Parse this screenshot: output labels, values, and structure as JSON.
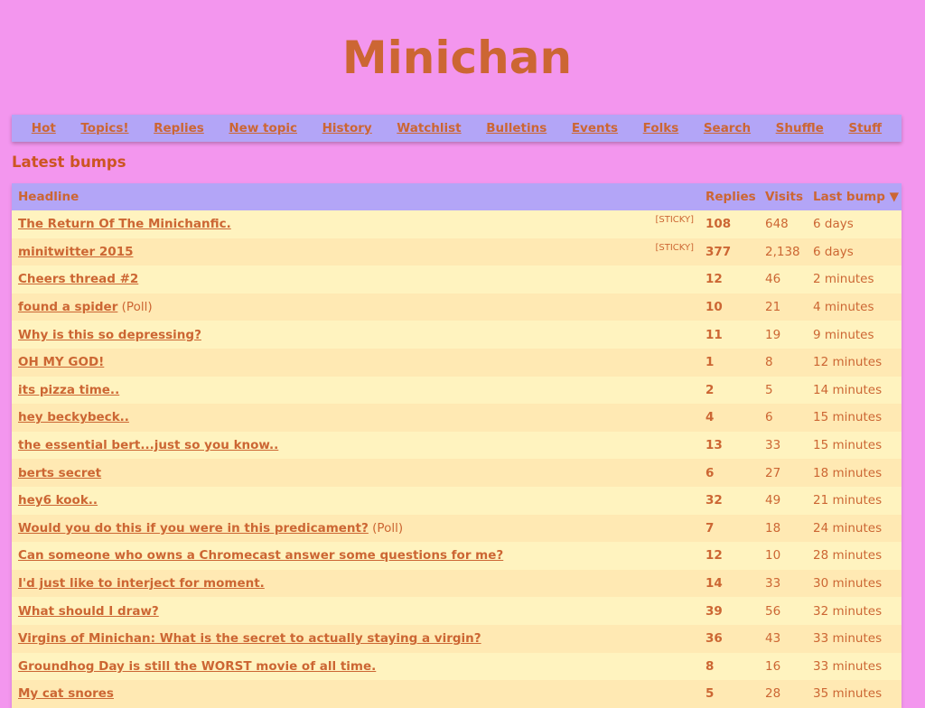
{
  "site": {
    "title": "Minichan"
  },
  "nav": {
    "items": [
      {
        "label": "Hot",
        "name": "nav-hot"
      },
      {
        "label": "Topics!",
        "name": "nav-topics"
      },
      {
        "label": "Replies",
        "name": "nav-replies"
      },
      {
        "label": "New topic",
        "name": "nav-new-topic"
      },
      {
        "label": "History",
        "name": "nav-history"
      },
      {
        "label": "Watchlist",
        "name": "nav-watchlist"
      },
      {
        "label": "Bulletins",
        "name": "nav-bulletins"
      },
      {
        "label": "Events",
        "name": "nav-events"
      },
      {
        "label": "Folks",
        "name": "nav-folks"
      },
      {
        "label": "Search",
        "name": "nav-search"
      },
      {
        "label": "Shuffle",
        "name": "nav-shuffle"
      },
      {
        "label": "Stuff",
        "name": "nav-stuff"
      }
    ]
  },
  "main": {
    "heading": "Latest bumps",
    "table": {
      "columns": {
        "headline": "Headline",
        "replies": "Replies",
        "visits": "Visits",
        "last_bump": "Last bump ▼"
      },
      "rows": [
        {
          "headline": "The Return Of The Minichanfic.",
          "sticky": "[STICKY]",
          "poll": "",
          "replies": "108",
          "visits": "648",
          "last_bump": "6 days"
        },
        {
          "headline": "minitwitter 2015",
          "sticky": "[STICKY]",
          "poll": "",
          "replies": "377",
          "visits": "2,138",
          "last_bump": "6 days"
        },
        {
          "headline": "Cheers thread #2",
          "sticky": "",
          "poll": "",
          "replies": "12",
          "visits": "46",
          "last_bump": "2 minutes"
        },
        {
          "headline": "found a spider",
          "sticky": "",
          "poll": "(Poll)",
          "replies": "10",
          "visits": "21",
          "last_bump": "4 minutes"
        },
        {
          "headline": "Why is this so depressing?",
          "sticky": "",
          "poll": "",
          "replies": "11",
          "visits": "19",
          "last_bump": "9 minutes"
        },
        {
          "headline": "OH MY GOD!",
          "sticky": "",
          "poll": "",
          "replies": "1",
          "visits": "8",
          "last_bump": "12 minutes"
        },
        {
          "headline": "its pizza time..",
          "sticky": "",
          "poll": "",
          "replies": "2",
          "visits": "5",
          "last_bump": "14 minutes"
        },
        {
          "headline": "hey beckybeck..",
          "sticky": "",
          "poll": "",
          "replies": "4",
          "visits": "6",
          "last_bump": "15 minutes"
        },
        {
          "headline": "the essential bert...just so you know..",
          "sticky": "",
          "poll": "",
          "replies": "13",
          "visits": "33",
          "last_bump": "15 minutes"
        },
        {
          "headline": "berts secret",
          "sticky": "",
          "poll": "",
          "replies": "6",
          "visits": "27",
          "last_bump": "18 minutes"
        },
        {
          "headline": "hey6 kook..",
          "sticky": "",
          "poll": "",
          "replies": "32",
          "visits": "49",
          "last_bump": "21 minutes"
        },
        {
          "headline": "Would you do this if you were in this predicament?",
          "sticky": "",
          "poll": "(Poll)",
          "replies": "7",
          "visits": "18",
          "last_bump": "24 minutes"
        },
        {
          "headline": "Can someone who owns a Chromecast answer some questions for me?",
          "sticky": "",
          "poll": "",
          "replies": "12",
          "visits": "10",
          "last_bump": "28 minutes"
        },
        {
          "headline": "I'd just like to interject for moment.",
          "sticky": "",
          "poll": "",
          "replies": "14",
          "visits": "33",
          "last_bump": "30 minutes"
        },
        {
          "headline": "What should I draw?",
          "sticky": "",
          "poll": "",
          "replies": "39",
          "visits": "56",
          "last_bump": "32 minutes"
        },
        {
          "headline": "Virgins of Minichan: What is the secret to actually staying a virgin?",
          "sticky": "",
          "poll": "",
          "replies": "36",
          "visits": "43",
          "last_bump": "33 minutes"
        },
        {
          "headline": "Groundhog Day is still the WORST movie of all time.",
          "sticky": "",
          "poll": "",
          "replies": "8",
          "visits": "16",
          "last_bump": "33 minutes"
        },
        {
          "headline": "My cat snores",
          "sticky": "",
          "poll": "",
          "replies": "5",
          "visits": "28",
          "last_bump": "35 minutes"
        }
      ]
    }
  }
}
